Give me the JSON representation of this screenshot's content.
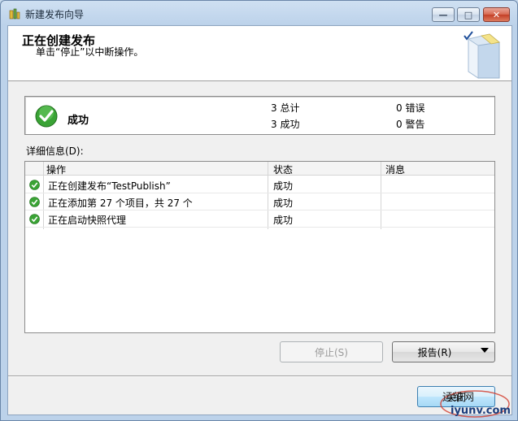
{
  "window": {
    "title": "新建发布向导"
  },
  "header": {
    "title": "正在创建发布",
    "subtitle": "单击“停止”以中断操作。"
  },
  "summary": {
    "status": "成功",
    "total": "3 总计",
    "success": "3 成功",
    "errors": "0 错误",
    "warnings": "0 警告"
  },
  "details": {
    "label": "详细信息(D):",
    "columns": {
      "action": "操作",
      "status": "状态",
      "message": "消息"
    },
    "rows": [
      {
        "action": "正在创建发布“TestPublish”",
        "status": "成功",
        "message": ""
      },
      {
        "action": "正在添加第 27 个项目，共 27 个",
        "status": "成功",
        "message": ""
      },
      {
        "action": "正在启动快照代理",
        "status": "成功",
        "message": ""
      }
    ]
  },
  "buttons": {
    "stop": "停止(S)",
    "report": "报告(R)",
    "close": "关闭"
  },
  "watermark": {
    "line1": "运维网",
    "line2": "iyunv.com"
  },
  "colors": {
    "success_green": "#3aa335",
    "titlebar": "#bcd2ea"
  }
}
